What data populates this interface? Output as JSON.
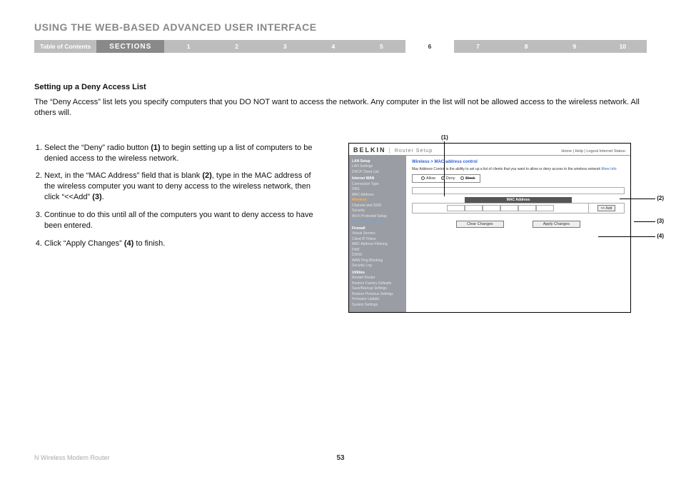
{
  "title": "USING THE WEB-BASED ADVANCED USER INTERFACE",
  "nav": {
    "toc": "Table of Contents",
    "sections": "SECTIONS",
    "nums": [
      "1",
      "2",
      "3",
      "4",
      "5",
      "6",
      "7",
      "8",
      "9",
      "10"
    ],
    "current": "6"
  },
  "subheading": "Setting up a Deny Access List",
  "intro": "The “Deny Access” list lets you specify computers that you DO NOT want to access the network. Any computer in the list will not be allowed access to the wireless network. All others will.",
  "steps": [
    {
      "n": "1.",
      "pre": "Select the “Deny” radio button ",
      "ref": "(1)",
      "post": " to begin setting up a list of computers to be denied access to the wireless network."
    },
    {
      "n": "2.",
      "pre": "Next, in the “MAC Address” field that is blank ",
      "ref": "(2)",
      "post": ", type in the MAC address of the wireless computer you want to deny access to the wireless network, then click “<<Add” ",
      "ref2": "(3)",
      "post2": "."
    },
    {
      "n": "3.",
      "pre": "Continue to do this until all of the computers you want to deny access to have been entered.",
      "ref": "",
      "post": ""
    },
    {
      "n": "4.",
      "pre": "Click “Apply Changes” ",
      "ref": "(4)",
      "post": " to finish."
    }
  ],
  "callouts": {
    "c1": "(1)",
    "c2": "(2)",
    "c3": "(3)",
    "c4": "(4)"
  },
  "shot": {
    "brand": "BELKIN",
    "brand_sub": "Router Setup",
    "toplinks": "Home | Help | Logout   Internet Status:",
    "sidebar": {
      "groups": [
        {
          "head": "LAN Setup",
          "items": [
            "LAN Settings",
            "DHCP Client List"
          ]
        },
        {
          "head": "Internet WAN",
          "items": [
            "Connection Type",
            "DNS",
            "MAC Address"
          ]
        },
        {
          "head_wireless": "Wireless",
          "items": [
            "Channel and SSID",
            "Security",
            "Wi-Fi Protected Setup"
          ],
          "mac": "MAC Address Control"
        },
        {
          "head": "Firewall",
          "items": [
            "Virtual Servers",
            "Client IP Filters",
            "MAC Address Filtering",
            "DMZ",
            "DDNS",
            "WAN Ping Blocking",
            "Security Log"
          ]
        },
        {
          "head": "Utilities",
          "items": [
            "Restart Router",
            "Restore Factory Defaults",
            "Save/Backup Settings",
            "Restore Previous Settings",
            "Firmware Update",
            "System Settings"
          ]
        }
      ]
    },
    "crumb": "Wireless > MAC address control",
    "desc": "Mac Address Control is the ability to set up a list of clients that you want to allow or deny access to the wireless network ",
    "more": "More Info",
    "opt_allow": "Allow",
    "opt_deny": "Deny",
    "opt_block": "Block",
    "mac_head": "MAC Address",
    "add_btn": "<< Add",
    "clear_btn": "Clear Changes",
    "apply_btn": "Apply Changes"
  },
  "footer": {
    "product": "N Wireless Modem Router",
    "page": "53"
  }
}
